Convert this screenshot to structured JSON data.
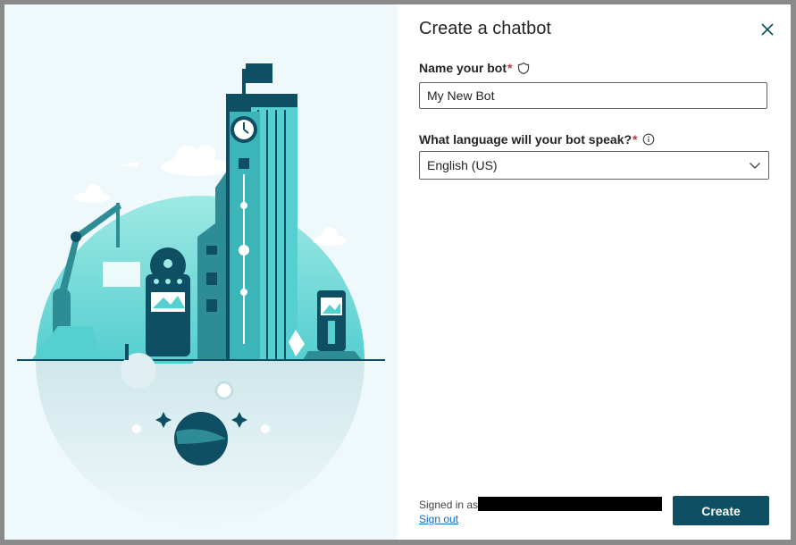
{
  "dialog": {
    "title": "Create a chatbot",
    "close_icon": "close-icon"
  },
  "name_field": {
    "label": "Name your bot",
    "required_marker": "*",
    "info_icon": "shield-icon",
    "value": "My New Bot"
  },
  "language_field": {
    "label": "What language will your bot speak?",
    "required_marker": "*",
    "info_icon": "info-icon",
    "selected": "English (US)",
    "dropdown_icon": "chevron-down-icon"
  },
  "footer": {
    "signed_in_label": "Signed in as",
    "sign_out_label": "Sign out",
    "create_label": "Create"
  },
  "colors": {
    "primary_button": "#0e4f64",
    "illustration_bg": "#eff8fb",
    "teal": "#7adcd8",
    "dark_teal": "#0e4f64",
    "required": "#c4314b"
  }
}
